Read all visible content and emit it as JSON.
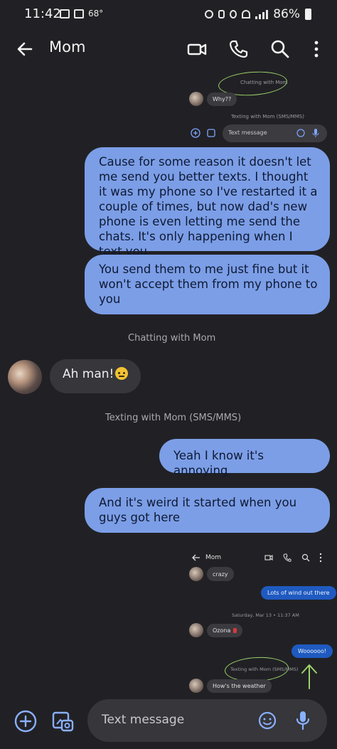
{
  "status": {
    "time": "11:42",
    "temp": "68°",
    "battery": "86%"
  },
  "header": {
    "contact": "Mom"
  },
  "embedded_top": {
    "chatting_label": "Chatting with Mom",
    "why_message": "Why??",
    "texting_label": "Texting with Mom (SMS/MMS)",
    "compose_placeholder": "Text message"
  },
  "messages": [
    {
      "dir": "out",
      "text": "Cause for some reason it doesn't let me send you better texts. I thought it was my phone so I've restarted it a couple of times, but now dad's new phone is even letting me send the chats. It's only happening when I text you"
    },
    {
      "dir": "out",
      "text": "You send them to me just fine but it won't accept them from my phone to you"
    },
    {
      "dir": "label",
      "text": "Chatting with Mom"
    },
    {
      "dir": "in",
      "text": "Ah man!"
    },
    {
      "dir": "label",
      "text": "Texting with Mom (SMS/MMS)"
    },
    {
      "dir": "out",
      "text": "Yeah I know it's annoying"
    },
    {
      "dir": "out",
      "text": "And it's weird it started when you guys got here"
    }
  ],
  "embedded_bottom": {
    "contact": "Mom",
    "partial_message": "crazy",
    "wind_message": "Lots of wind out there",
    "date_label": "Saturday, Mar 13 • 11:37 AM",
    "ozona_message": "Ozona",
    "woo_message": "Woooooo!",
    "texting_label": "Texting with Mom (SMS/MMS)",
    "weather_message": "How's the weather"
  },
  "compose": {
    "placeholder": "Text message"
  },
  "colors": {
    "background": "#212125",
    "outgoing_bubble": "#7c9ee7",
    "incoming_bubble": "#36363b",
    "annotation_green": "#9ed16a"
  }
}
